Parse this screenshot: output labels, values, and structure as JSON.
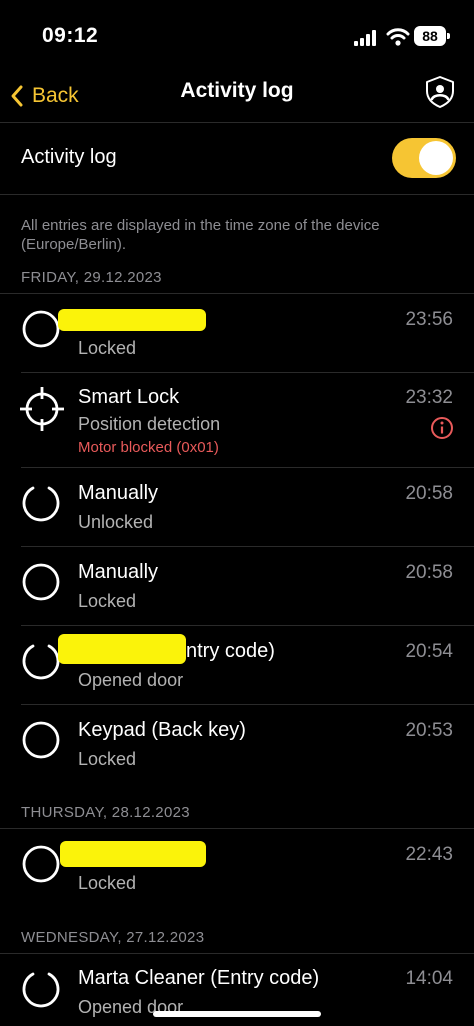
{
  "status": {
    "time": "09:12",
    "battery": "88"
  },
  "nav": {
    "back_label": "Back",
    "title": "Activity log"
  },
  "toggle": {
    "label": "Activity log",
    "on": true
  },
  "info_text": "All entries are displayed in the time zone of the device (Europe/Berlin).",
  "sections": [
    {
      "header": "FRIDAY, 29.12.2023"
    },
    {
      "header": "THURSDAY, 28.12.2023"
    },
    {
      "header": "WEDNESDAY, 27.12.2023"
    }
  ],
  "entries": [
    {
      "title": "",
      "subtitle": "Locked",
      "time": "23:56",
      "icon": "circle-icon"
    },
    {
      "title": "Smart Lock",
      "subtitle": "Position detection",
      "error": "Motor blocked (0x01)",
      "time": "23:32",
      "icon": "crosshair-icon"
    },
    {
      "title": "Manually",
      "subtitle": "Unlocked",
      "time": "20:58",
      "icon": "open-circle-icon"
    },
    {
      "title": "Manually",
      "subtitle": "Locked",
      "time": "20:58",
      "icon": "circle-icon"
    },
    {
      "title": "ntry code)",
      "subtitle": "Opened door",
      "time": "20:54",
      "icon": "open-circle-icon"
    },
    {
      "title": "Keypad (Back key)",
      "subtitle": "Locked",
      "time": "20:53",
      "icon": "circle-icon"
    },
    {
      "title": "",
      "subtitle": "Locked",
      "time": "22:43",
      "icon": "circle-icon"
    },
    {
      "title": "Marta Cleaner (Entry code)",
      "subtitle": "Opened door",
      "time": "14:04",
      "icon": "open-circle-icon"
    }
  ],
  "colors": {
    "accent": "#f6c533",
    "error": "#e85a5a",
    "redaction": "#fbf30a"
  }
}
